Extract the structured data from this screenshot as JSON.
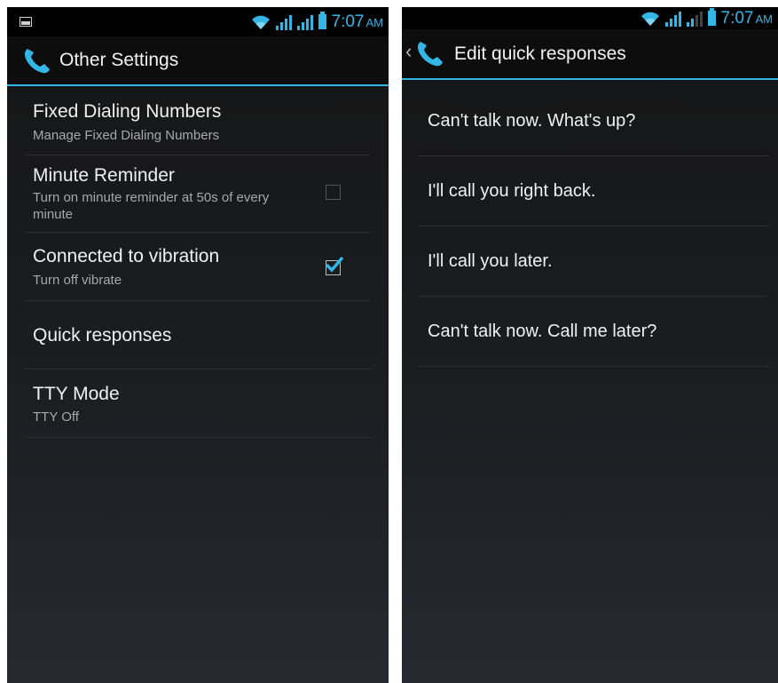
{
  "left_screen": {
    "status_bar": {
      "time": "7:07",
      "ampm": "AM"
    },
    "action_bar": {
      "title": "Other Settings"
    },
    "items": [
      {
        "title": "Fixed Dialing Numbers",
        "summary": "Manage Fixed Dialing Numbers"
      },
      {
        "title": "Minute Reminder",
        "summary": "Turn on minute reminder at 50s of every minute",
        "checked": false
      },
      {
        "title": "Connected to vibration",
        "summary": "Turn off vibrate",
        "checked": true
      },
      {
        "title": "Quick responses"
      },
      {
        "title": "TTY Mode",
        "summary": "TTY Off"
      }
    ]
  },
  "right_screen": {
    "status_bar": {
      "time": "7:07",
      "ampm": "AM"
    },
    "action_bar": {
      "title": "Edit quick responses"
    },
    "responses": [
      "Can't talk now. What's up?",
      "I'll call you right back.",
      "I'll call you later.",
      "Can't talk now. Call me later?"
    ]
  },
  "colors": {
    "accent": "#33b5e5",
    "background": "#1a1c20",
    "text": "#f0f0f0",
    "secondary_text": "#a8a8a8"
  }
}
